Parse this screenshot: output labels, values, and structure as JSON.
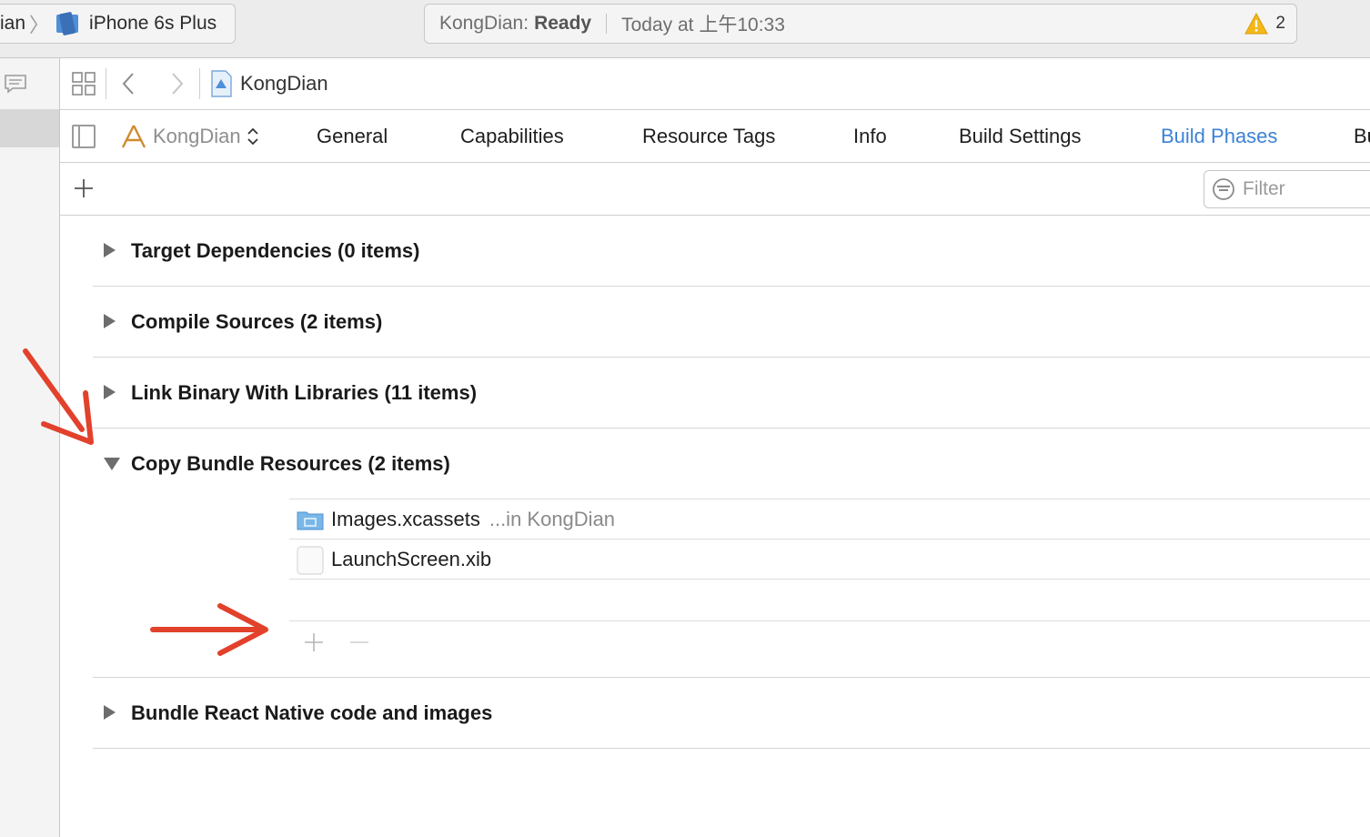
{
  "toolbar": {
    "scheme_project": "ian",
    "device": "iPhone 6s Plus",
    "status_project": "KongDian:",
    "status_state": "Ready",
    "status_time": "Today at 上午10:33",
    "warning_count": "2"
  },
  "jumpbar": {
    "crumb": "KongDian"
  },
  "tabs": {
    "target": "KongDian",
    "items": [
      {
        "label": "General"
      },
      {
        "label": "Capabilities"
      },
      {
        "label": "Resource Tags"
      },
      {
        "label": "Info"
      },
      {
        "label": "Build Settings"
      },
      {
        "label": "Build Phases"
      },
      {
        "label": "Bu"
      }
    ],
    "active": "Build Phases"
  },
  "filter": {
    "placeholder": "Filter"
  },
  "phases": [
    {
      "title": "Target Dependencies (0 items)",
      "expanded": false
    },
    {
      "title": "Compile Sources (2 items)",
      "expanded": false
    },
    {
      "title": "Link Binary With Libraries (11 items)",
      "expanded": false
    },
    {
      "title": "Copy Bundle Resources (2 items)",
      "expanded": true
    },
    {
      "title": "Bundle React Native code and images",
      "expanded": false
    }
  ],
  "resources": [
    {
      "name": "Images.xcassets",
      "location": "...in KongDian",
      "icon": "folder-icon"
    },
    {
      "name": "LaunchScreen.xib",
      "location": "",
      "icon": "xib-file-icon"
    }
  ],
  "colors": {
    "accent": "#3b82d6",
    "annotation_arrow": "#e2412b",
    "warning": "#f5b81b"
  }
}
